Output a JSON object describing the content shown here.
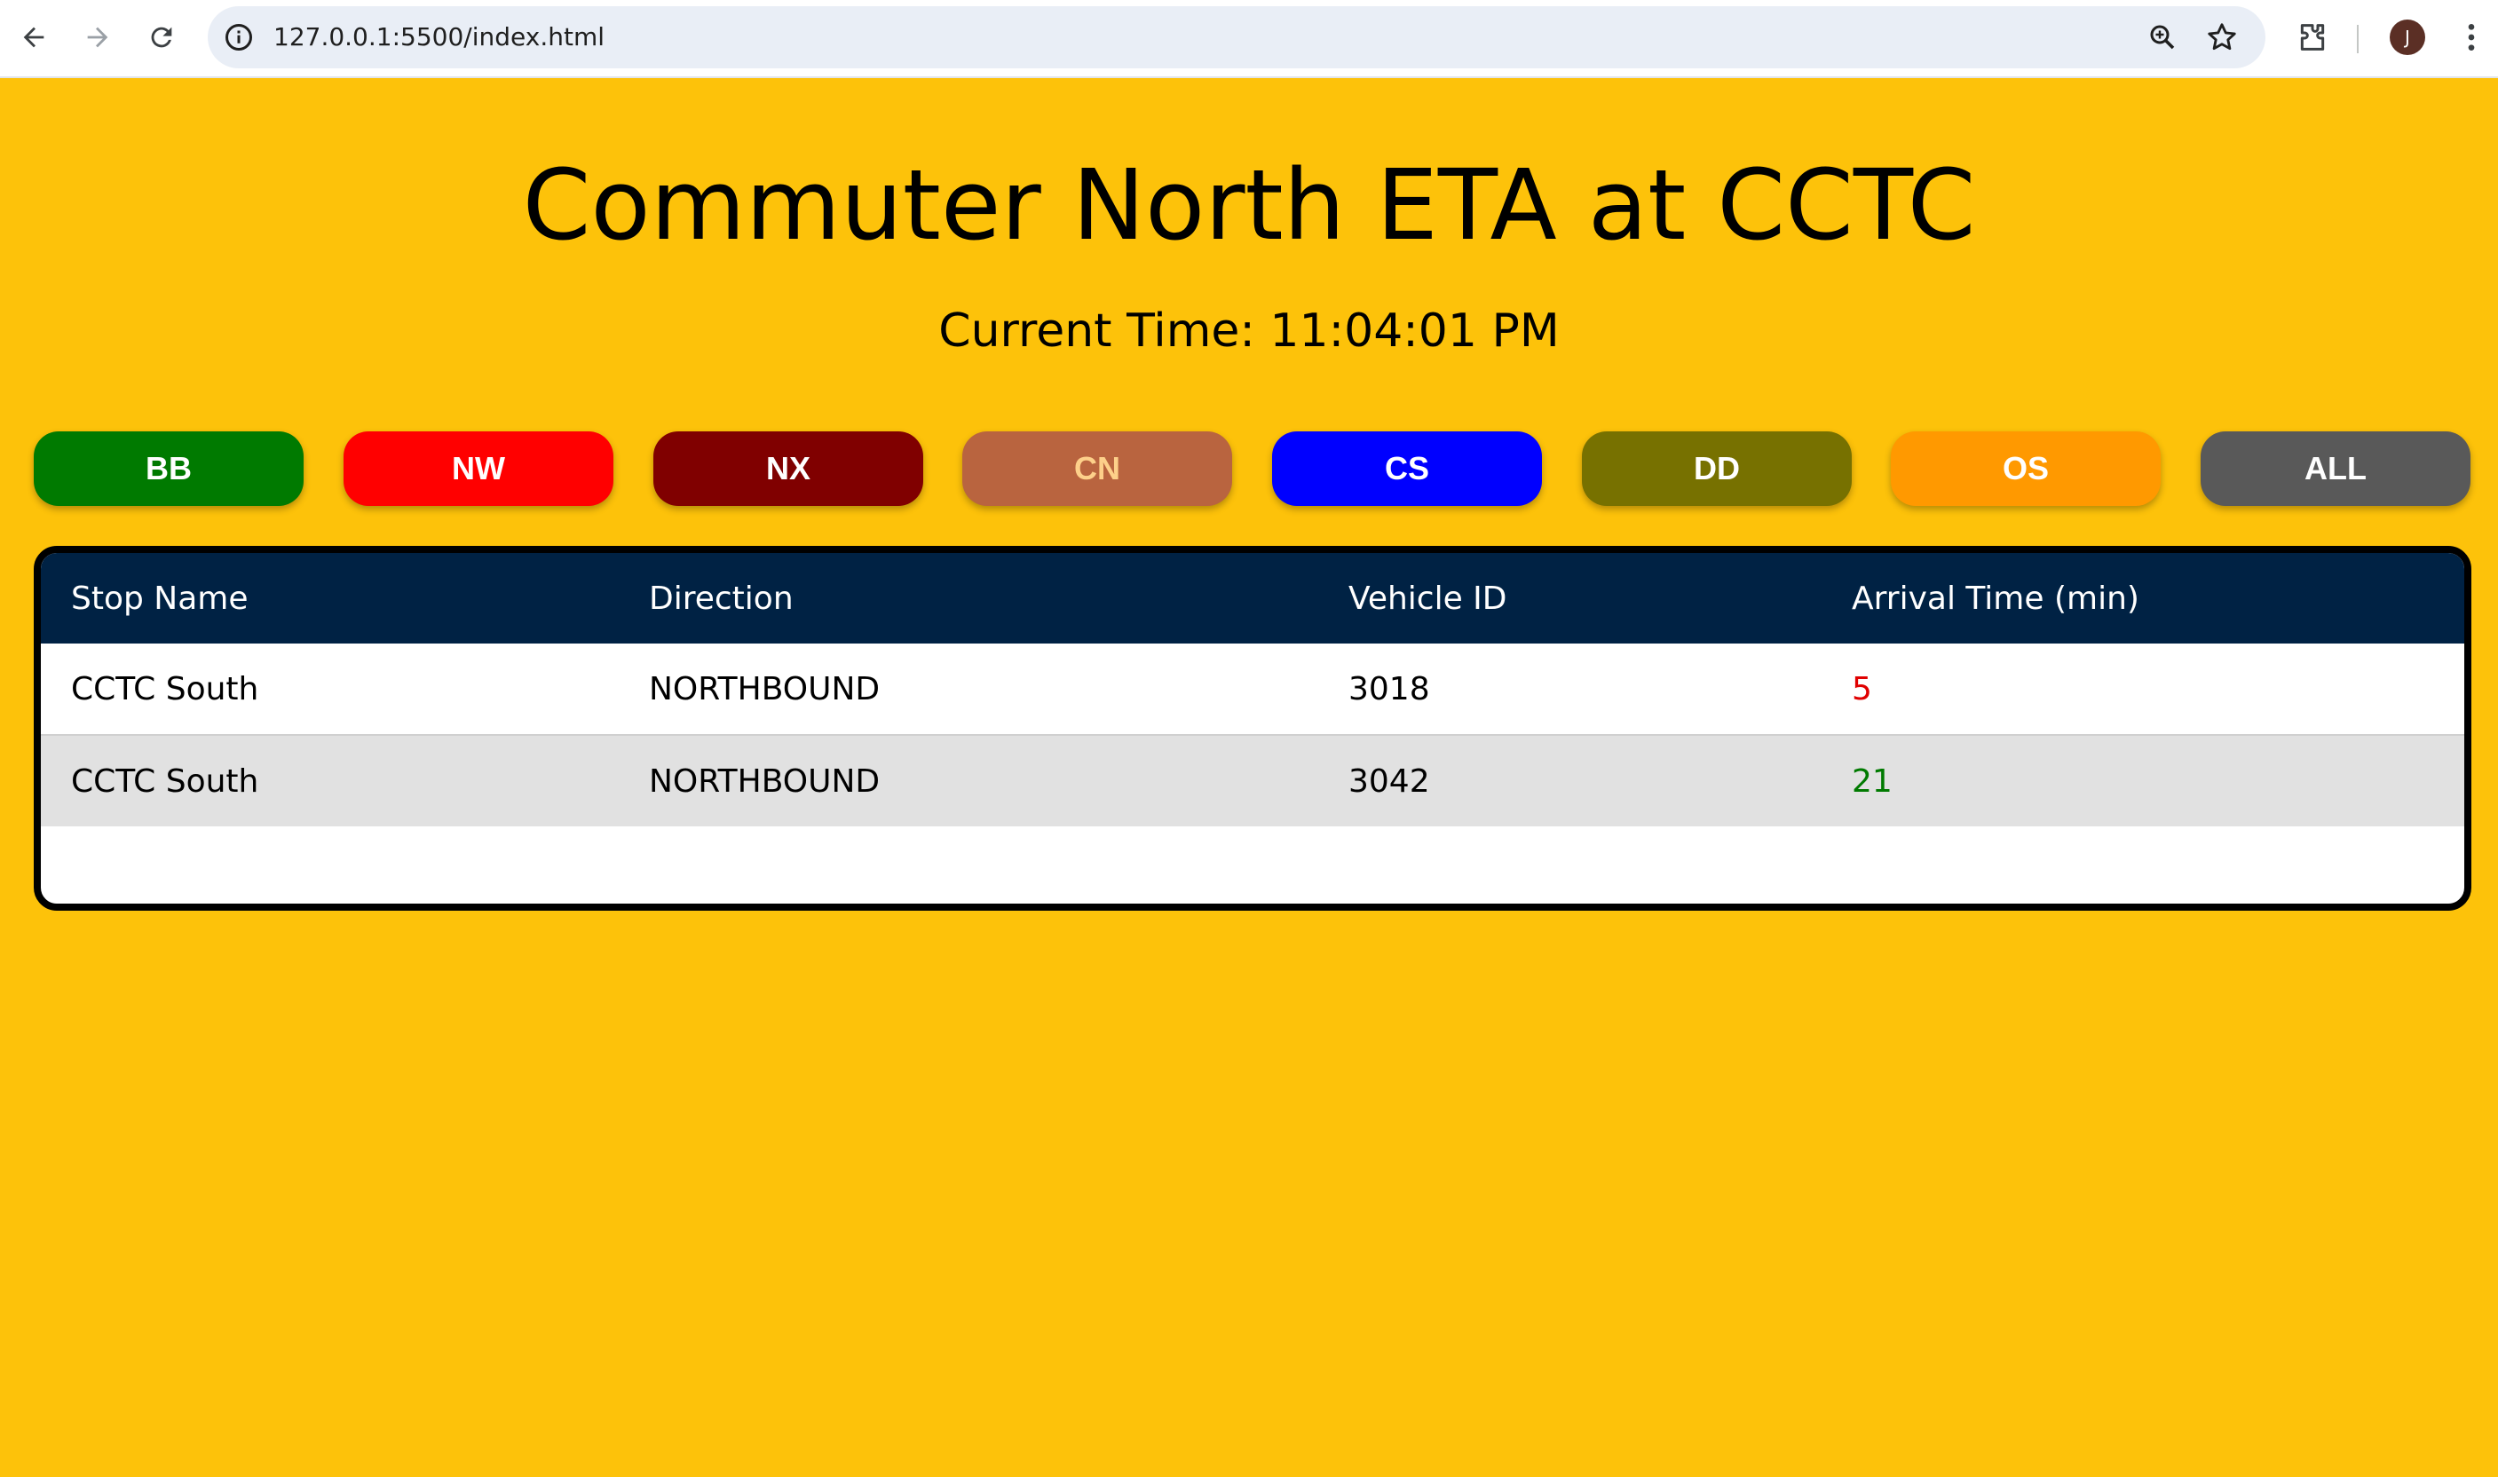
{
  "browser": {
    "url": "127.0.0.1:5500/index.html",
    "profile_initial": "J",
    "icons": {
      "back": "arrow-left-icon",
      "forward": "arrow-right-icon",
      "reload": "reload-icon",
      "site_info": "info-icon",
      "zoom": "zoom-icon",
      "bookmark": "star-icon",
      "extensions": "puzzle-icon",
      "menu": "kebab-menu-icon"
    }
  },
  "page": {
    "title": "Commuter North ETA at CCTC",
    "current_time_label": "Current Time:",
    "current_time_value": "11:04:01 PM",
    "background_color": "#fdc20a"
  },
  "routes": [
    {
      "label": "BB",
      "color": "#007a00",
      "text_color": "#ffffff"
    },
    {
      "label": "NW",
      "color": "#ff0000",
      "text_color": "#ffffff"
    },
    {
      "label": "NX",
      "color": "#800000",
      "text_color": "#ffffff"
    },
    {
      "label": "CN",
      "color": "#b9643f",
      "text_color": "#fdd08a"
    },
    {
      "label": "CS",
      "color": "#0000ff",
      "text_color": "#ffffff"
    },
    {
      "label": "DD",
      "color": "#777100",
      "text_color": "#ffffff"
    },
    {
      "label": "OS",
      "color": "#ff9900",
      "text_color": "#ffffff"
    },
    {
      "label": "ALL",
      "color": "#595959",
      "text_color": "#ffffff"
    }
  ],
  "table": {
    "headers": [
      "Stop Name",
      "Direction",
      "Vehicle ID",
      "Arrival Time (min)"
    ],
    "rows": [
      {
        "stop": "CCTC South",
        "direction": "NORTHBOUND",
        "vehicle": "3018",
        "arrival": "5",
        "arrival_color": "#e00000"
      },
      {
        "stop": "CCTC South",
        "direction": "NORTHBOUND",
        "vehicle": "3042",
        "arrival": "21",
        "arrival_color": "#007a00"
      }
    ],
    "header_bg": "#002244"
  }
}
